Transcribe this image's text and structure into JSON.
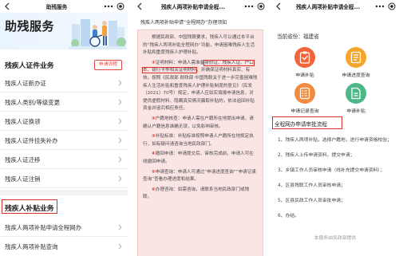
{
  "left": {
    "topbar_title": "助残服务",
    "hero_title": "助残服务",
    "section1": {
      "title": "残疾人证件业务",
      "tag": "申请流程",
      "items": [
        "残疾人证新办证",
        "残疾人类别/等级变更",
        "残疾人证换领",
        "残疾人证件挂失补办",
        "残疾人证迁移",
        "残疾人证注销"
      ]
    },
    "section2": {
      "title": "残疾人补贴业务",
      "items": [
        "残疾人两项补贴申请全程网办",
        "残疾人两项补贴查询"
      ]
    }
  },
  "middle": {
    "topbar_title": "残疾人两项补贴申请全程...",
    "notice_title": "残疾人两项补贴申请“全程网办”办理须知",
    "intro": "根据民政部、中国残联要求，残疾人可以通过本平台的“残疾人两项补贴全程网办”功能，申请困难残疾人生活补贴和重度残疾人护理补贴。",
    "item1": {
      "num": "①",
      "prefix": "证明材料：申请人需准备",
      "highlight": "身份证、残疾人证、户口本、银行卡等相关证明材料",
      "suffix": "，并确保证明材料真实、有效。按照《民政部 财政部 中国残联关于进一步完善困难残疾人生活补贴和重度残疾人护理补贴制度的意见》（民发〔2021〕70号）规定，申请人应如实填报申请信息，对提供虚假材料、隐瞒真实情况骗取补贴的，依法追回补贴资金并追究相应责任。"
    },
    "items": [
      {
        "num": "②",
        "text": "户籍地核查：申请人需在户籍所在地提出申请，请确认户籍信息准确无误，以免影响审核。"
      },
      {
        "num": "③",
        "text": "补贴标准：补贴标准按照申请人户籍所在地规定执行，如有疑问请咨询当地民政部门。"
      },
      {
        "num": "④",
        "text": "撤回申请：申请提交后、审核完成前，申请人可在线撤回申请。"
      },
      {
        "num": "⑤",
        "text": "申请查询：申请人可通过“申请进度查询”“申请记录查询”查看办理进度和结果。"
      },
      {
        "num": "⑥",
        "text": "办理咨询：如需咨询，请联系当地民政部门或残联。"
      }
    ]
  },
  "right": {
    "topbar_title": "残疾人两项补贴申请全程...",
    "province_label": "当前省份：",
    "province_value": "福建省",
    "grid": [
      {
        "label": "申请补贴",
        "icon": "apply-icon",
        "color": "#f2643a"
      },
      {
        "label": "申请进度查询",
        "icon": "progress-icon",
        "color": "#f4a62a"
      },
      {
        "label": "申请记录查询",
        "icon": "record-icon",
        "color": "#f08a3e"
      },
      {
        "label": "申请补贴",
        "icon": "document-icon",
        "color": "#4cb787"
      }
    ],
    "flow_title": "全程网办申请审批流程",
    "steps": [
      "1、残疾人两项补贴，选择户籍地，进行申请资格校验；",
      "2、残疾人上传申请资料，提交申请；",
      "3、乡镇工作人员审核申请（线补充提交申请资料）；",
      "4、区县残联工作人员审核申请；",
      "5、区县民政工作人员审批申请；",
      "6、办结。"
    ],
    "footer": "本服务由民政部提供"
  },
  "colors": {
    "highlight_red": "#d8312b",
    "notice_bg": "#fbe4e4",
    "hero_bg": "#eaf4fd"
  }
}
